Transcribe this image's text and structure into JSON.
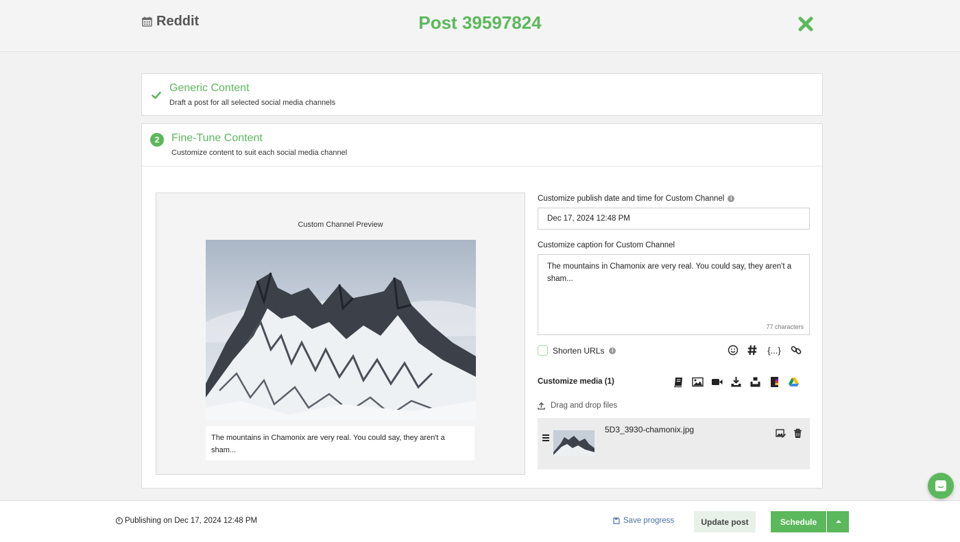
{
  "header": {
    "channel_name": "Reddit",
    "channel_icon": "calendar-icon",
    "post_title": "Post 39597824",
    "close_icon": "close-icon",
    "accent_color": "#5cb85c"
  },
  "steps": [
    {
      "title": "Generic Content",
      "description": "Draft a post for all selected social media channels",
      "status": "completed"
    },
    {
      "number": "2",
      "title": "Fine-Tune Content",
      "description": "Customize content to suit each social media channel",
      "status": "active"
    }
  ],
  "preview": {
    "title": "Custom Channel Preview",
    "caption": "The mountains in Chamonix are very real. You could say, they aren't a sham..."
  },
  "form": {
    "date_label": "Customize publish date and time for Custom Channel",
    "date_value": "Dec 17, 2024 12:48 PM",
    "caption_label": "Customize caption for Custom Channel",
    "caption_value": "The mountains in Chamonix are very real. You could say, they aren't a sham...",
    "char_count": "77 characters",
    "shorten_urls_label": "Shorten URLs",
    "shorten_urls_checked": false,
    "caption_tools": [
      "emoji-icon",
      "hashtag-icon",
      "variables-icon",
      "link-icon"
    ],
    "braces_glyph": "{...}",
    "media_label": "Customize media (1)",
    "media_sources": [
      "library-icon",
      "image-icon",
      "video-icon",
      "download-icon",
      "dropbox-icon",
      "canva-icon",
      "google-drive-icon"
    ],
    "drag_drop_label": "Drag and drop files",
    "files": [
      {
        "name": "5D3_3930-chamonix.jpg"
      }
    ]
  },
  "footer": {
    "publishing_text": "Publishing on Dec 17, 2024 12:48 PM",
    "save_progress_label": "Save progress",
    "update_label": "Update post",
    "schedule_label": "Schedule"
  }
}
